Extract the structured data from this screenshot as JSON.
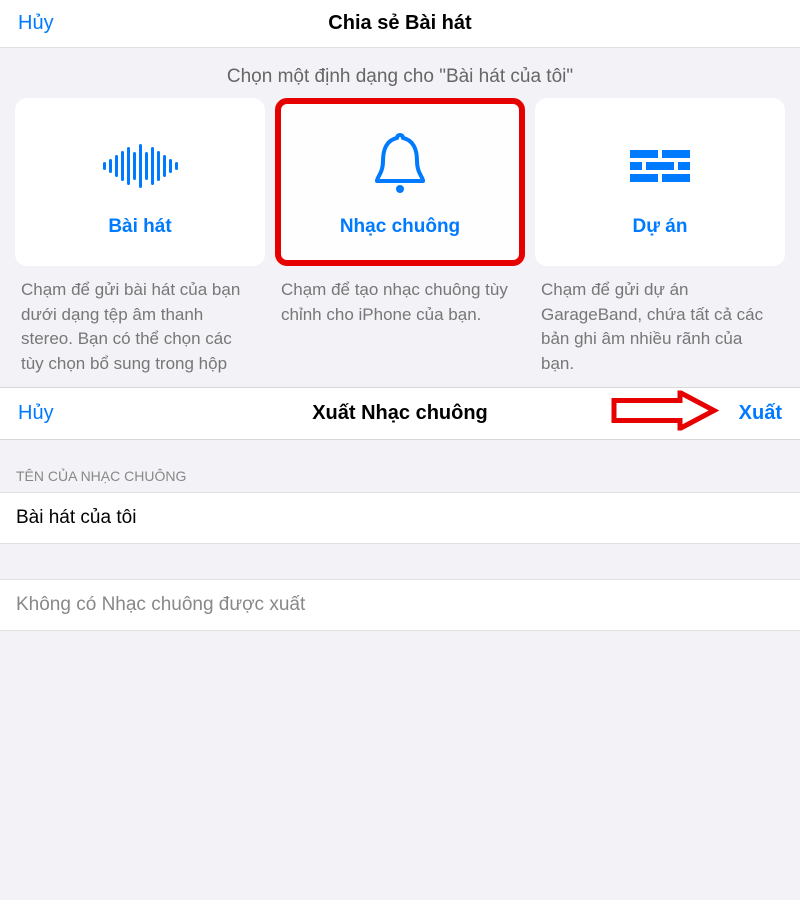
{
  "colors": {
    "accent": "#007aff",
    "highlight": "#e60000"
  },
  "header1": {
    "cancel": "Hủy",
    "title": "Chia sẻ Bài hát"
  },
  "subtitle": "Chọn một định dạng cho \"Bài hát của tôi\"",
  "cards": {
    "song": {
      "icon": "waveform-icon",
      "label": "Bài hát",
      "desc": "Chạm để gửi bài hát của bạn dưới dạng tệp âm thanh stereo. Bạn có thể chọn các tùy chọn bổ sung trong hộp"
    },
    "ringtone": {
      "icon": "bell-icon",
      "label": "Nhạc chuông",
      "desc": "Chạm để tạo nhạc chuông tùy chỉnh cho iPhone của bạn."
    },
    "project": {
      "icon": "bricks-icon",
      "label": "Dự án",
      "desc": "Chạm để gửi dự án GarageBand, chứa tất cả các bản ghi âm nhiều rãnh của bạn."
    }
  },
  "header2": {
    "cancel": "Hủy",
    "title": "Xuất Nhạc chuông",
    "export": "Xuất"
  },
  "section": {
    "label": "TÊN CỦA NHẠC CHUÔNG",
    "value": "Bài hát của tôi"
  },
  "status": "Không có Nhạc chuông được xuất"
}
